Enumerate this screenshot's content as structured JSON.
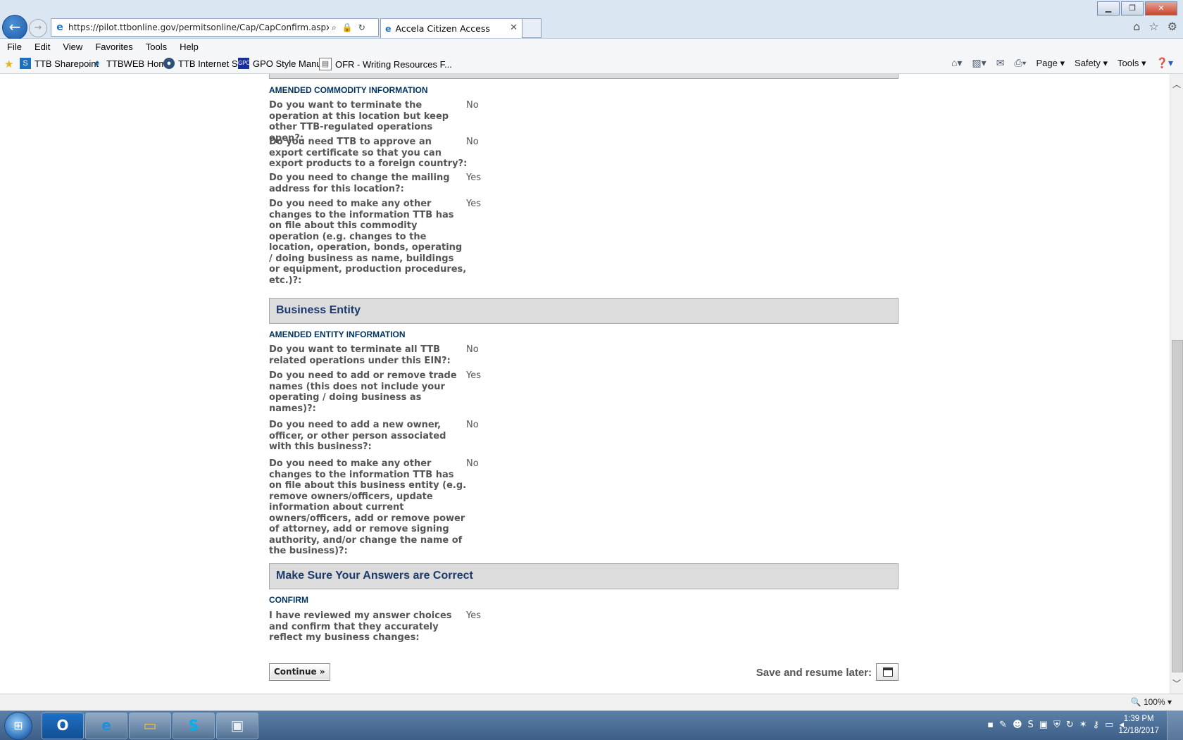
{
  "browser": {
    "url": "https://pilot.ttbonline.gov/permitsonline/Cap/CapConfirm.aspx?stepN",
    "tab_title": "Accela Citizen Access",
    "menu": [
      "File",
      "Edit",
      "View",
      "Favorites",
      "Tools",
      "Help"
    ],
    "favorites": [
      "TTB Sharepoint",
      "TTBWEB Home",
      "TTB Internet Site",
      "GPO Style Manual",
      "OFR - Writing Resources F..."
    ],
    "command_bar": {
      "page": "Page",
      "safety": "Safety",
      "tools": "Tools"
    },
    "zoom": "100%"
  },
  "form": {
    "amended_commodity": {
      "heading": "AMENDED COMMODITY INFORMATION",
      "questions": [
        {
          "q": "Do you want to terminate the operation at this location but keep other TTB-regulated operations open?:",
          "a": "No"
        },
        {
          "q": "Do you need TTB to approve an export certificate so that you can export products to a foreign country?:",
          "a": "No"
        },
        {
          "q": "Do you need to change the mailing address for this location?:",
          "a": "Yes"
        },
        {
          "q": "Do you need to make any other changes to the information TTB has on file about this commodity operation (e.g. changes to the location, operation, bonds, operating / doing business as name, buildings or equipment, production procedures, etc.)?:",
          "a": "Yes"
        }
      ]
    },
    "business_entity": {
      "title": "Business Entity",
      "heading": "AMENDED ENTITY INFORMATION",
      "questions": [
        {
          "q": "Do you want to terminate all TTB related operations under this EIN?:",
          "a": "No"
        },
        {
          "q": "Do you need to add or remove trade names (this does not include your operating / doing business as names)?:",
          "a": "Yes"
        },
        {
          "q": "Do you need to add a new owner, officer, or other person associated with this business?:",
          "a": "No"
        },
        {
          "q": "Do you need to make any other changes to the information TTB has on file about this business entity (e.g. remove owners/officers, update information about current owners/officers, add or remove power of attorney, add or remove signing authority, and/or change the name of the business)?:",
          "a": "No"
        }
      ]
    },
    "confirm_section": {
      "title": "Make Sure Your Answers are Correct",
      "heading": "CONFIRM",
      "questions": [
        {
          "q": "I have reviewed my answer choices and confirm that they accurately reflect my business changes:",
          "a": "Yes"
        }
      ]
    },
    "continue_label": "Continue »",
    "save_later_label": "Save and resume later:"
  },
  "taskbar": {
    "time": "1:39 PM",
    "date": "12/18/2017"
  }
}
